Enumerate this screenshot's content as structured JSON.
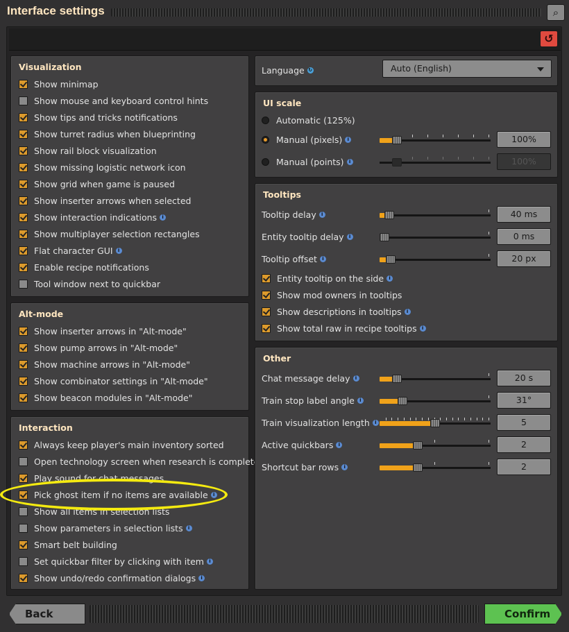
{
  "window": {
    "title": "Interface settings",
    "search_icon": "magnifier",
    "reset_icon": "reset-arrow"
  },
  "visualization": {
    "heading": "Visualization",
    "items": [
      {
        "label": "Show minimap",
        "checked": true,
        "info": false
      },
      {
        "label": "Show mouse and keyboard control hints",
        "checked": false,
        "info": false
      },
      {
        "label": "Show tips and tricks notifications",
        "checked": true,
        "info": false
      },
      {
        "label": "Show turret radius when blueprinting",
        "checked": true,
        "info": false
      },
      {
        "label": "Show rail block visualization",
        "checked": true,
        "info": false
      },
      {
        "label": "Show missing logistic network icon",
        "checked": true,
        "info": false
      },
      {
        "label": "Show grid when game is paused",
        "checked": true,
        "info": false
      },
      {
        "label": "Show inserter arrows when selected",
        "checked": true,
        "info": false
      },
      {
        "label": "Show interaction indications",
        "checked": true,
        "info": true
      },
      {
        "label": "Show multiplayer selection rectangles",
        "checked": true,
        "info": false
      },
      {
        "label": "Flat character GUI",
        "checked": true,
        "info": true
      },
      {
        "label": "Enable recipe notifications",
        "checked": true,
        "info": false
      },
      {
        "label": "Tool window next to quickbar",
        "checked": false,
        "info": false
      }
    ]
  },
  "altmode": {
    "heading": "Alt-mode",
    "items": [
      {
        "label": "Show inserter arrows in \"Alt-mode\"",
        "checked": true,
        "info": false
      },
      {
        "label": "Show pump arrows in \"Alt-mode\"",
        "checked": true,
        "info": false
      },
      {
        "label": "Show machine arrows in \"Alt-mode\"",
        "checked": true,
        "info": false
      },
      {
        "label": "Show combinator settings in \"Alt-mode\"",
        "checked": true,
        "info": false
      },
      {
        "label": "Show beacon modules in \"Alt-mode\"",
        "checked": true,
        "info": false
      }
    ]
  },
  "interaction": {
    "heading": "Interaction",
    "items": [
      {
        "label": "Always keep player's main inventory sorted",
        "checked": true,
        "info": false
      },
      {
        "label": "Open technology screen when research is completed",
        "checked": false,
        "info": false
      },
      {
        "label": "Play sound for chat messages",
        "checked": true,
        "info": false
      },
      {
        "label": "Pick ghost item if no items are available",
        "checked": true,
        "info": true
      },
      {
        "label": "Show all items in selection lists",
        "checked": false,
        "info": false
      },
      {
        "label": "Show parameters in selection lists",
        "checked": false,
        "info": true
      },
      {
        "label": "Smart belt building",
        "checked": true,
        "info": false
      },
      {
        "label": "Set quickbar filter by clicking with item",
        "checked": false,
        "info": true
      },
      {
        "label": "Show undo/redo confirmation dialogs",
        "checked": true,
        "info": true
      }
    ]
  },
  "language": {
    "label": "Language",
    "value": "Auto (English)"
  },
  "uiscale": {
    "heading": "UI scale",
    "automatic": "Automatic (125%)",
    "manual_pixels": "Manual (pixels)",
    "manual_points": "Manual (points)",
    "pixels_value": "100%",
    "points_value": "100%",
    "selected": "manual_pixels"
  },
  "tooltips": {
    "heading": "Tooltips",
    "sliders": [
      {
        "label": "Tooltip delay",
        "value": "40 ms",
        "fraction": 0.05
      },
      {
        "label": "Entity tooltip delay",
        "value": "0 ms",
        "fraction": 0.0
      },
      {
        "label": "Tooltip offset",
        "value": "20 px",
        "fraction": 0.06
      }
    ],
    "items": [
      {
        "label": "Entity tooltip on the side",
        "checked": true,
        "info": true
      },
      {
        "label": "Show mod owners in tooltips",
        "checked": true,
        "info": false
      },
      {
        "label": "Show descriptions in tooltips",
        "checked": true,
        "info": true
      },
      {
        "label": "Show total raw in recipe tooltips",
        "checked": true,
        "info": true
      }
    ]
  },
  "other": {
    "heading": "Other",
    "sliders": [
      {
        "label": "Chat message delay",
        "value": "20 s",
        "fraction": 0.12
      },
      {
        "label": "Train stop label angle",
        "value": "31°",
        "fraction": 0.18
      },
      {
        "label": "Train visualization length",
        "value": "5",
        "fraction": 0.5
      },
      {
        "label": "Active quickbars",
        "value": "2",
        "fraction": 0.33
      },
      {
        "label": "Shortcut bar rows",
        "value": "2",
        "fraction": 0.33
      }
    ]
  },
  "buttons": {
    "back": "Back",
    "confirm": "Confirm"
  },
  "colors": {
    "accent": "#f0a21a",
    "heading": "#ffe6c0",
    "confirm": "#5dc251",
    "reset": "#e04a3f",
    "highlight": "#f4ea10"
  }
}
